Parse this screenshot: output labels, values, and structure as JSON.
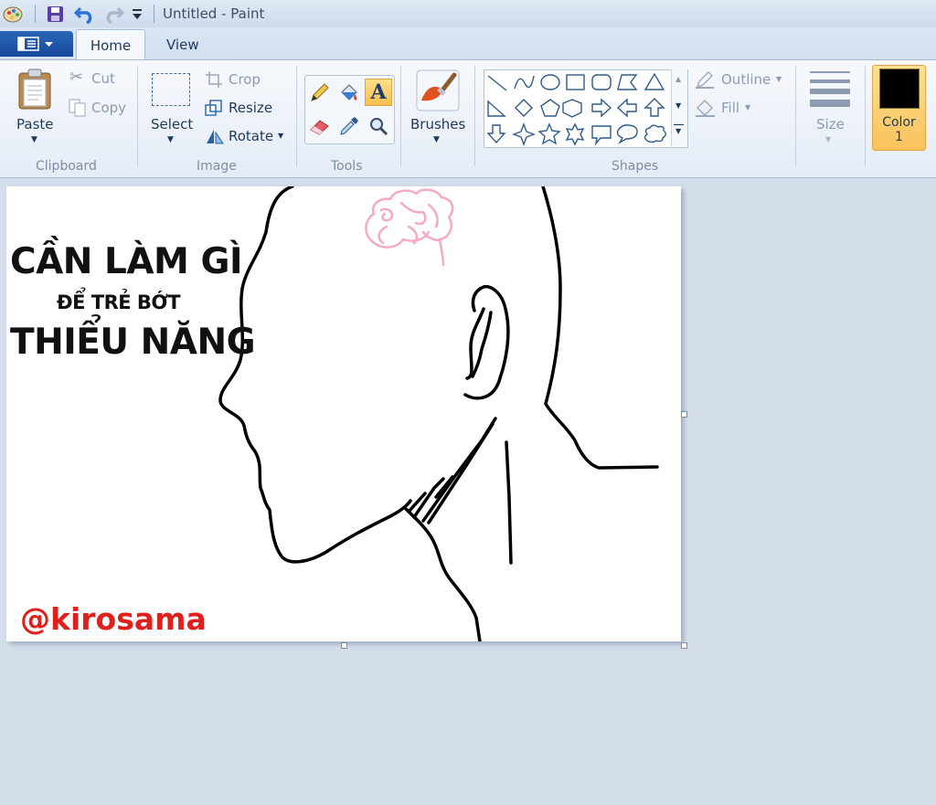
{
  "window": {
    "title": "Untitled - Paint"
  },
  "tabs": {
    "home": "Home",
    "view": "View"
  },
  "clipboard": {
    "paste": "Paste",
    "cut": "Cut",
    "copy": "Copy",
    "label": "Clipboard"
  },
  "image": {
    "select": "Select",
    "crop": "Crop",
    "resize": "Resize",
    "rotate": "Rotate",
    "label": "Image"
  },
  "tools": {
    "label": "Tools"
  },
  "brushes": {
    "label": "Brushes"
  },
  "shapes": {
    "outline": "Outline",
    "fill": "Fill",
    "label": "Shapes"
  },
  "size": {
    "label": "Size"
  },
  "color1": {
    "label_line1": "Color",
    "label_line2": "1",
    "value": "#000000"
  },
  "canvas": {
    "heading_line1": "CẦN LÀM GÌ",
    "heading_line2": "ĐỂ TRẺ BỚT",
    "heading_line3": "THIỂU NĂNG",
    "signature": "@kirosama",
    "signature_color": "#e0201c",
    "brain_color": "#f4a9c4"
  }
}
